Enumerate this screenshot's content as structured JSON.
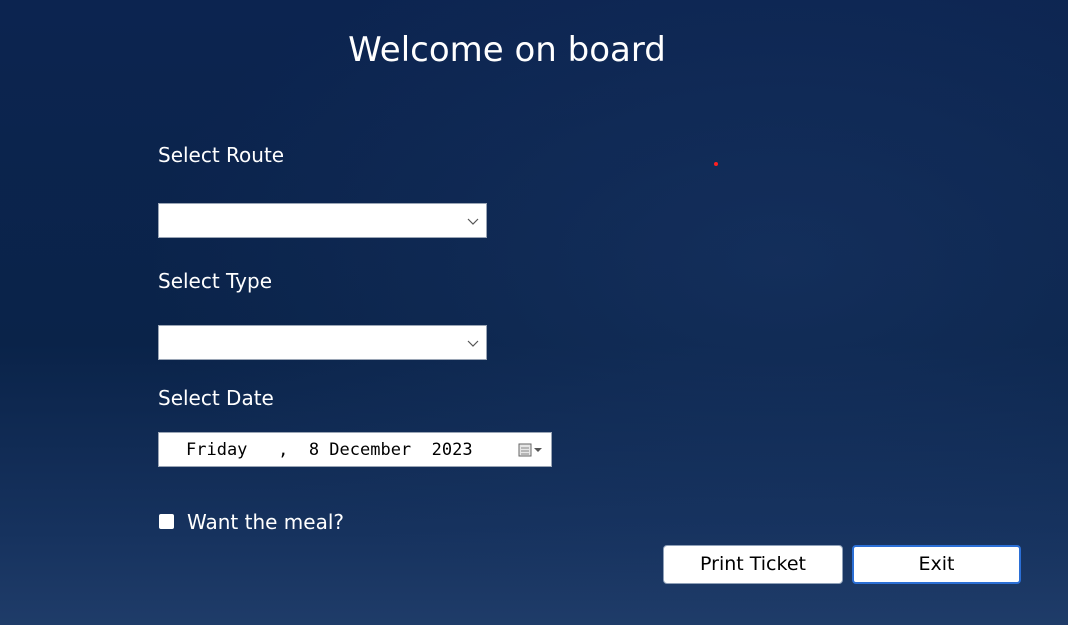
{
  "title": "Welcome on board",
  "form": {
    "route": {
      "label": "Select Route",
      "value": ""
    },
    "type": {
      "label": "Select Type",
      "value": ""
    },
    "date": {
      "label": "Select Date",
      "value": "Friday   ,  8 December  2023"
    },
    "meal": {
      "label": "Want the meal?",
      "checked": false
    }
  },
  "buttons": {
    "print": "Print Ticket",
    "exit": "Exit"
  },
  "colors": {
    "background": "#0c2450",
    "focus_border": "#2b6fd6",
    "marker": "#ff2020"
  },
  "icons": {
    "dropdown": "chevron-down-icon",
    "calendar": "calendar-icon"
  }
}
